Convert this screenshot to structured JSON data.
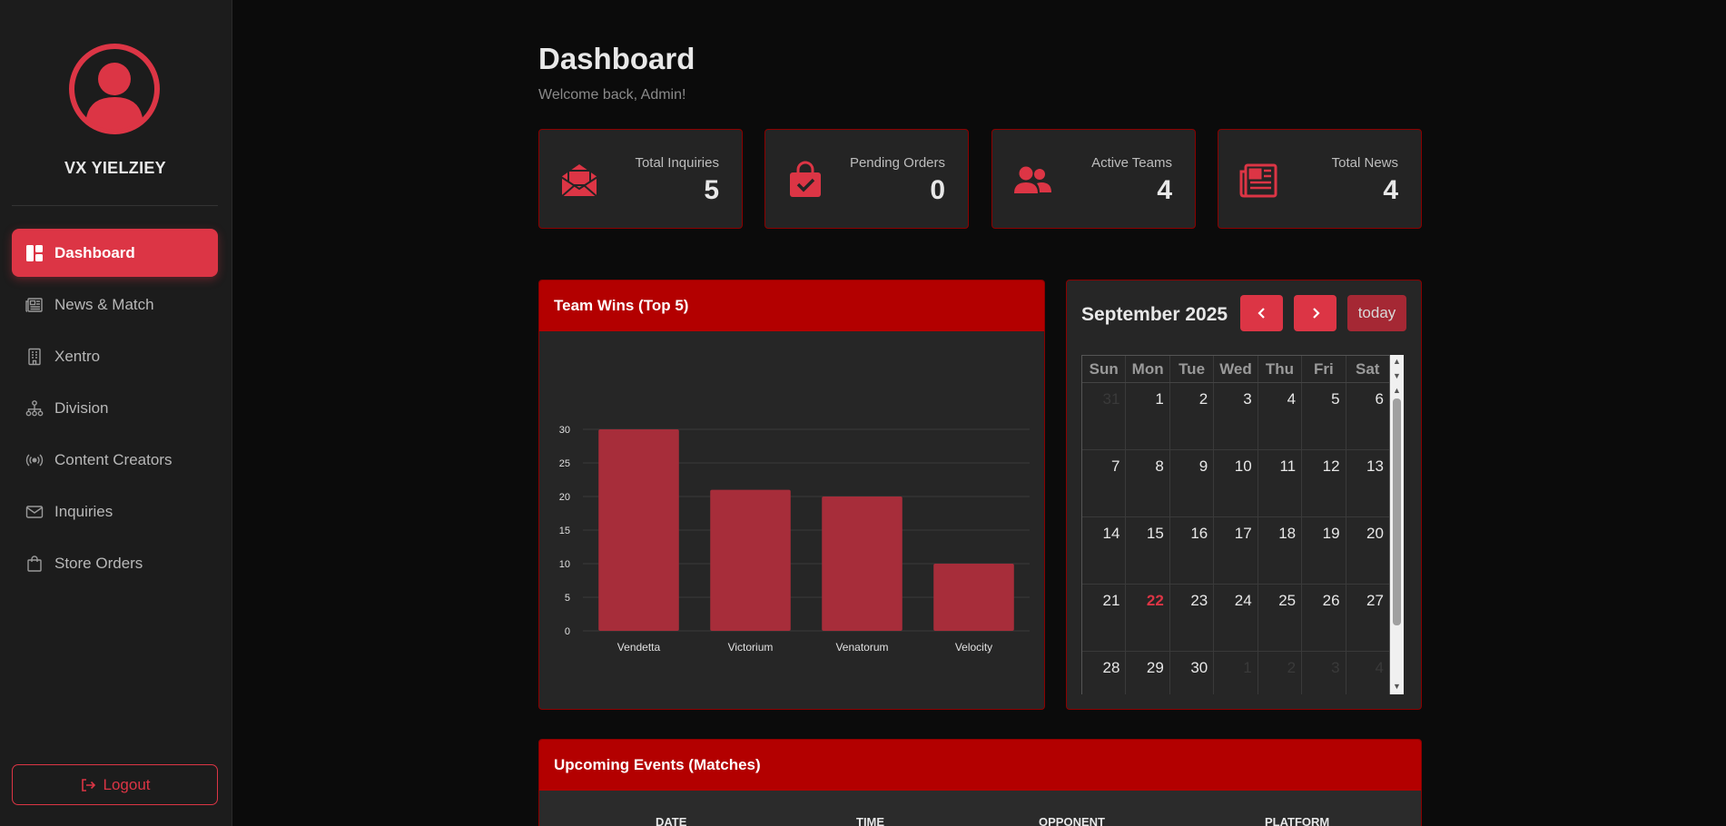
{
  "sidebar": {
    "avatar_icon": "user-circle-icon",
    "brand": "VX YIELZIEY",
    "items": [
      {
        "label": "Dashboard",
        "icon": "dashboard-icon",
        "active": true
      },
      {
        "label": "News & Match",
        "icon": "newspaper-icon"
      },
      {
        "label": "Xentro",
        "icon": "building-icon"
      },
      {
        "label": "Division",
        "icon": "hierarchy-icon"
      },
      {
        "label": "Content Creators",
        "icon": "broadcast-icon"
      },
      {
        "label": "Inquiries",
        "icon": "envelope-icon"
      },
      {
        "label": "Store Orders",
        "icon": "shopping-bag-icon"
      }
    ],
    "logout": "Logout"
  },
  "header": {
    "title": "Dashboard",
    "subtitle": "Welcome back, Admin!"
  },
  "stats": [
    {
      "label": "Total Inquiries",
      "value": "5",
      "icon": "envelope-open-icon"
    },
    {
      "label": "Pending Orders",
      "value": "0",
      "icon": "bag-check-icon"
    },
    {
      "label": "Active Teams",
      "value": "4",
      "icon": "users-icon"
    },
    {
      "label": "Total News",
      "value": "4",
      "icon": "newspaper-icon"
    }
  ],
  "chart_card": {
    "title": "Team Wins (Top 5)"
  },
  "chart_data": {
    "type": "bar",
    "title": "Team Wins (Top 5)",
    "categories": [
      "Vendetta",
      "Victorium",
      "Venatorum",
      "Velocity"
    ],
    "values": [
      30,
      21,
      20,
      10
    ],
    "ylim": [
      0,
      30
    ],
    "yticks": [
      0,
      5,
      10,
      15,
      20,
      25,
      30
    ],
    "grid": true,
    "bar_color": "#a72d3a"
  },
  "calendar": {
    "title": "September 2025",
    "today_label": "today",
    "weekdays": [
      "Sun",
      "Mon",
      "Tue",
      "Wed",
      "Thu",
      "Fri",
      "Sat"
    ],
    "weeks": [
      [
        {
          "d": "31",
          "m": true
        },
        {
          "d": "1"
        },
        {
          "d": "2"
        },
        {
          "d": "3"
        },
        {
          "d": "4"
        },
        {
          "d": "5"
        },
        {
          "d": "6"
        }
      ],
      [
        {
          "d": "7"
        },
        {
          "d": "8"
        },
        {
          "d": "9"
        },
        {
          "d": "10"
        },
        {
          "d": "11"
        },
        {
          "d": "12"
        },
        {
          "d": "13"
        }
      ],
      [
        {
          "d": "14"
        },
        {
          "d": "15"
        },
        {
          "d": "16"
        },
        {
          "d": "17"
        },
        {
          "d": "18"
        },
        {
          "d": "19"
        },
        {
          "d": "20"
        }
      ],
      [
        {
          "d": "21"
        },
        {
          "d": "22",
          "today": true
        },
        {
          "d": "23"
        },
        {
          "d": "24"
        },
        {
          "d": "25"
        },
        {
          "d": "26"
        },
        {
          "d": "27"
        }
      ],
      [
        {
          "d": "28"
        },
        {
          "d": "29"
        },
        {
          "d": "30"
        },
        {
          "d": "1",
          "m": true
        },
        {
          "d": "2",
          "m": true
        },
        {
          "d": "3",
          "m": true
        },
        {
          "d": "4",
          "m": true
        }
      ]
    ]
  },
  "events": {
    "title": "Upcoming Events (Matches)",
    "columns": [
      "DATE",
      "TIME",
      "OPPONENT",
      "PLATFORM"
    ]
  },
  "colors": {
    "accent": "#dc3545",
    "header_red": "#b30000",
    "card_bg": "#262626",
    "page_bg": "#0b0b0b"
  }
}
